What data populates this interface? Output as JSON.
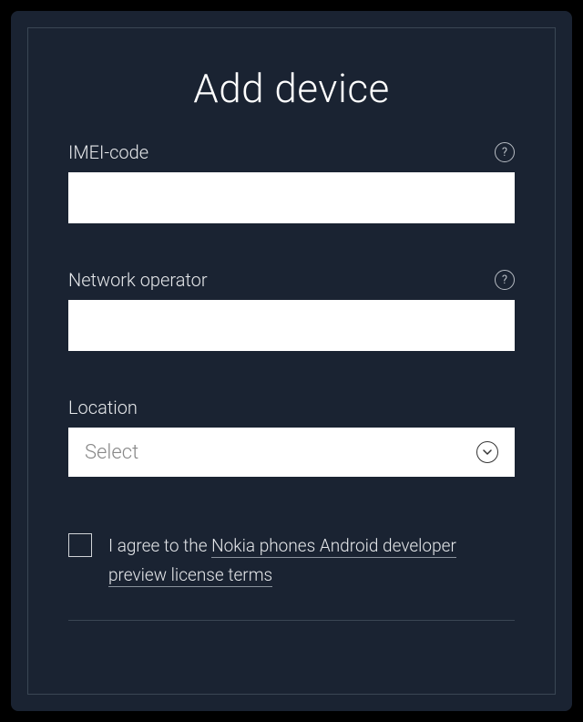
{
  "title": "Add device",
  "fields": {
    "imei": {
      "label": "IMEI-code",
      "value": ""
    },
    "operator": {
      "label": "Network operator",
      "value": ""
    },
    "location": {
      "label": "Location",
      "placeholder": "Select"
    }
  },
  "agreement": {
    "prefix": "I agree to the ",
    "link": "Nokia phones Android developer preview license terms"
  }
}
